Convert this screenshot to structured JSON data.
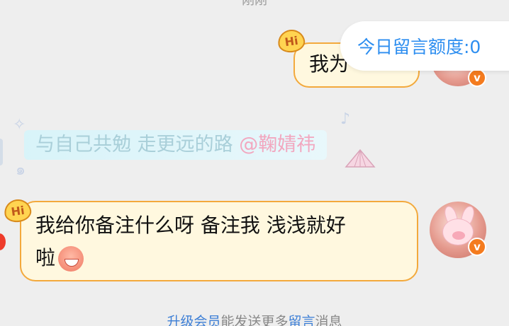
{
  "header": {
    "timestamp": "刚刚"
  },
  "quota": {
    "label": "今日留言额度:0"
  },
  "messages": [
    {
      "side": "right",
      "badge": "Hi",
      "text": "我为"
    },
    {
      "side": "left",
      "badge": "Hi",
      "text_line1": "我给你备注什么呀 备注我 浅浅就好",
      "text_line2": "啦"
    }
  ],
  "notice": {
    "text": "与自己共勉 走更远的路",
    "mention": "@鞠婧祎"
  },
  "avatar": {
    "vip_badge": "v"
  },
  "footer": {
    "link1": "升级会员",
    "mid_text": "能发送更多",
    "link2": "留言",
    "end_text": "消息"
  },
  "colors": {
    "bubble_bg": "#fff8df",
    "bubble_border": "#f3a93c",
    "accent_blue": "#2d8ef0",
    "vip_orange": "#f47b1e"
  }
}
